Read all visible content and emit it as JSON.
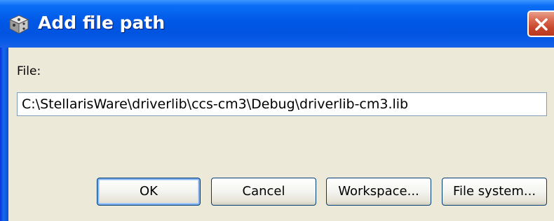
{
  "window": {
    "title": "Add file path",
    "icon": "app-cube-icon",
    "close_icon": "close-icon"
  },
  "form": {
    "file_label": "File:",
    "file_value": "C:\\StellarisWare\\driverlib\\ccs-cm3\\Debug\\driverlib-cm3.lib"
  },
  "buttons": {
    "ok": "OK",
    "cancel": "Cancel",
    "workspace": "Workspace...",
    "file_system": "File system..."
  },
  "colors": {
    "titlebar": "#0058e6",
    "close_button": "#c5452a",
    "dialog_background": "#ece9d8"
  }
}
